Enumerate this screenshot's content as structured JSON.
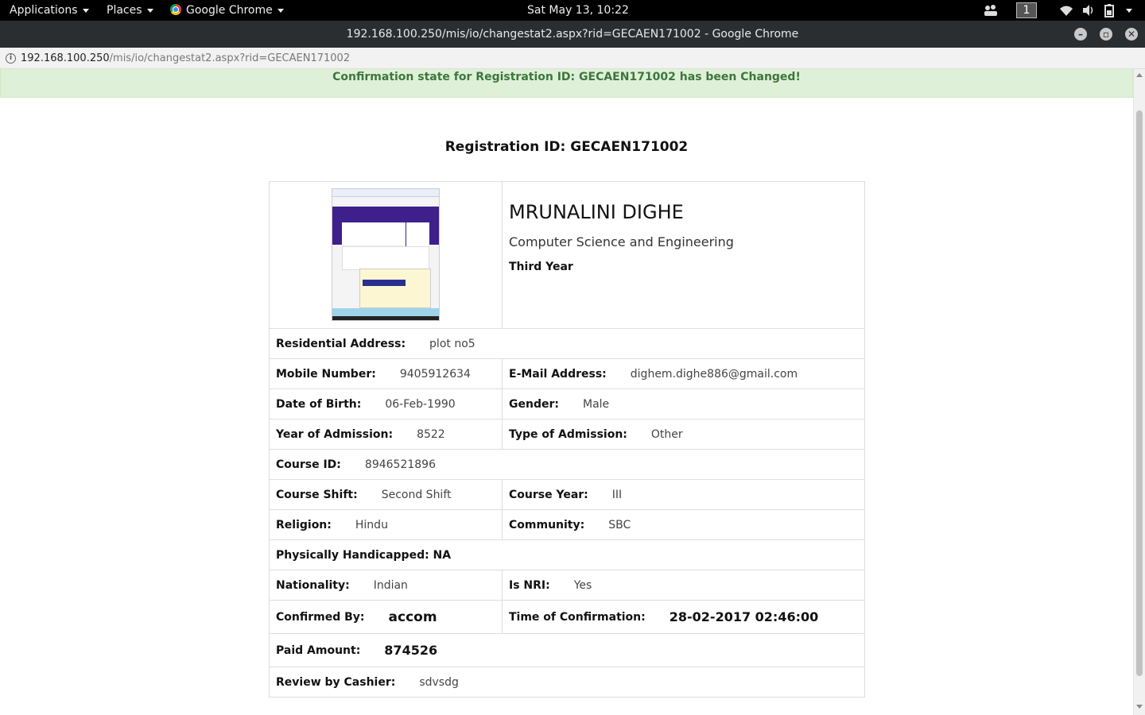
{
  "topbar": {
    "applications": "Applications",
    "places": "Places",
    "app_name": "Google Chrome",
    "datetime": "Sat May 13, 10:22",
    "workspace": "1"
  },
  "window": {
    "title": "192.168.100.250/mis/io/changestat2.aspx?rid=GECAEN171002 - Google Chrome"
  },
  "address": {
    "host": "192.168.100.250",
    "path": "/mis/io/changestat2.aspx?rid=GECAEN171002"
  },
  "alert": "Confirmation state for Registration ID: GECAEN171002 has been Changed!",
  "heading": "Registration ID: GECAEN171002",
  "student": {
    "name": "MRUNALINI DIGHE",
    "department": "Computer Science and Engineering",
    "year": "Third Year"
  },
  "fields": {
    "residential_address": {
      "label": "Residential Address:",
      "value": "plot no5"
    },
    "mobile": {
      "label": "Mobile Number:",
      "value": "9405912634"
    },
    "email": {
      "label": "E-Mail Address:",
      "value": "dighem.dighe886@gmail.com"
    },
    "dob": {
      "label": "Date of Birth:",
      "value": "06-Feb-1990"
    },
    "gender": {
      "label": "Gender:",
      "value": "Male"
    },
    "year_of_admission": {
      "label": "Year of Admission:",
      "value": "8522"
    },
    "type_of_admission": {
      "label": "Type of Admission:",
      "value": "Other"
    },
    "course_id": {
      "label": "Course ID:",
      "value": "8946521896"
    },
    "course_shift": {
      "label": "Course Shift:",
      "value": "Second Shift"
    },
    "course_year": {
      "label": "Course Year:",
      "value": "III"
    },
    "religion": {
      "label": "Religion:",
      "value": "Hindu"
    },
    "community": {
      "label": "Community:",
      "value": "SBC"
    },
    "physically_handicapped": {
      "label": "Physically Handicapped: NA"
    },
    "nationality": {
      "label": "Nationality:",
      "value": "Indian"
    },
    "is_nri": {
      "label": "Is NRI:",
      "value": "Yes"
    },
    "confirmed_by": {
      "label": "Confirmed By:",
      "value": "accom"
    },
    "time_of_confirmation": {
      "label": "Time of Confirmation:",
      "value": "28-02-2017 02:46:00"
    },
    "paid_amount": {
      "label": "Paid Amount:",
      "value": "874526"
    },
    "review_by_cashier": {
      "label": "Review by Cashier:",
      "value": "sdvsdg"
    }
  }
}
